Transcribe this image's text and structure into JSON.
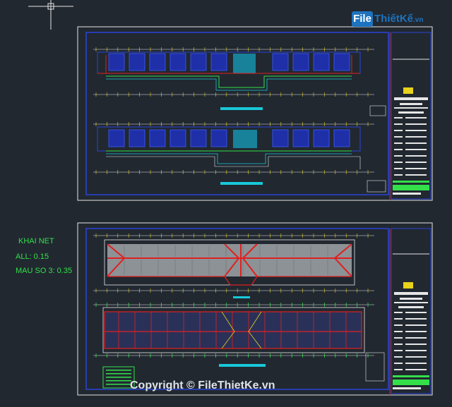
{
  "watermark": {
    "badge": "File",
    "name": "ThiếtKế",
    "domain": ".vn"
  },
  "layer_labels": {
    "title": "KHAI NET",
    "all": "ALL: 0.15",
    "mau_so_3": "MAU SO 3: 0.35"
  },
  "copyright": "Copyright © FileThietKe.vn",
  "colors": {
    "background": "#212830",
    "frame": "#e6e6e6",
    "blueprint_blue": "#2b44d8",
    "red": "#e02020",
    "green": "#33e04a",
    "cyan": "#18c8d8",
    "yellow": "#e8d21c",
    "roof_gray": "#8c9296"
  },
  "icons": {
    "crosshair": "ucs-crosshair-icon",
    "title_block": "title-block-logo-icon"
  }
}
